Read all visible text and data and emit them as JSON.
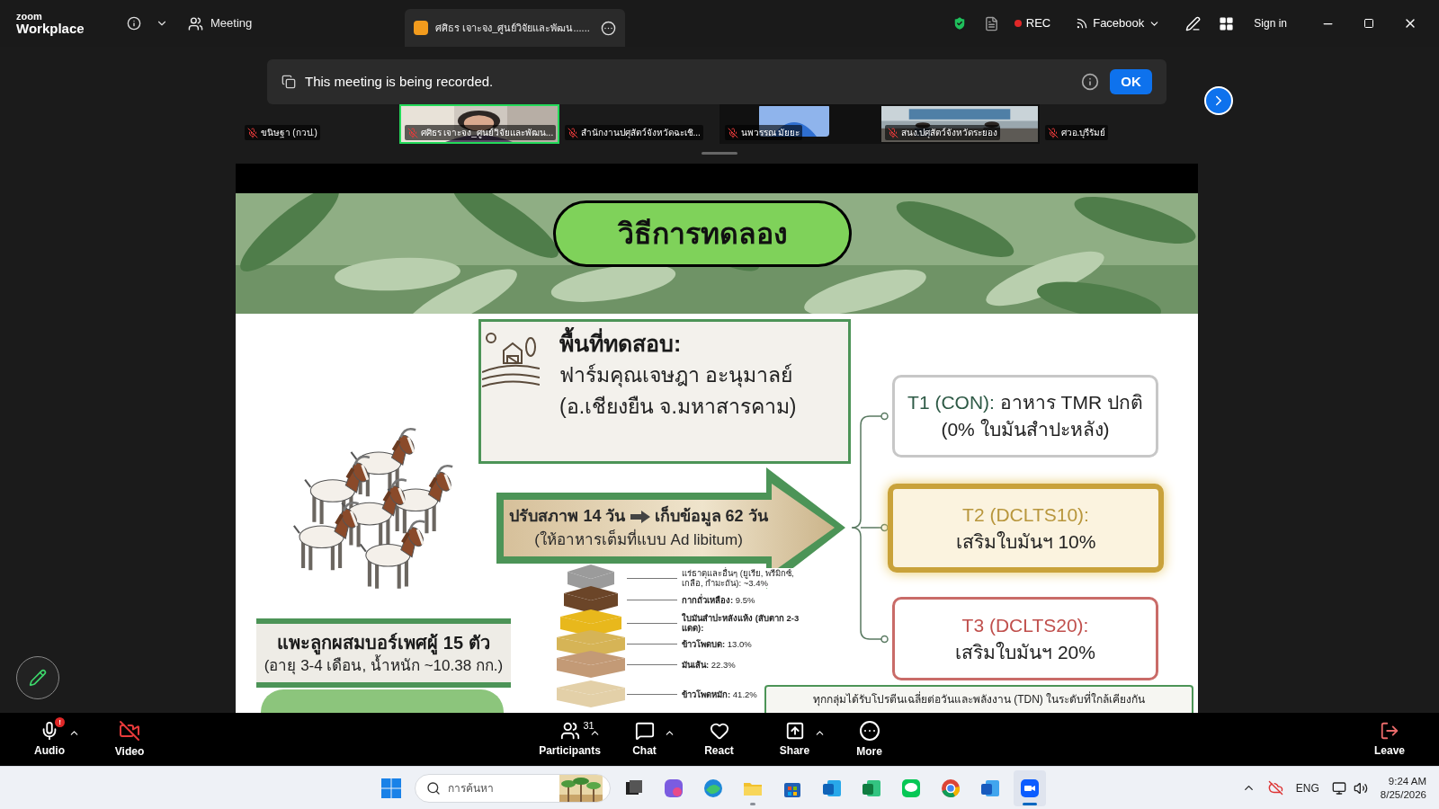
{
  "title_bar": {
    "logo_top": "zoom",
    "logo_bottom": "Workplace",
    "meeting_label": "Meeting",
    "tab_title": "ศศิธร เจาะจง_ศูนย์วิจัยและพัฒน......",
    "recording": "REC",
    "stream": "Facebook",
    "sign_in": "Sign in"
  },
  "banner": {
    "message": "This meeting is being recorded.",
    "button": "OK"
  },
  "participants": [
    {
      "name": "ขนิษฐา (กวป.)",
      "kind": "blank",
      "muted": true,
      "selected": false
    },
    {
      "name": "ศศิธร เจาะจง_ศูนย์วิจัยและพัฒน...",
      "kind": "person",
      "muted": true,
      "selected": true
    },
    {
      "name": "สำนักงานปศุสัตว์จังหวัดฉะเชิ...",
      "kind": "blank",
      "muted": true,
      "selected": false
    },
    {
      "name": "นพวรรณ มัยยะ",
      "kind": "avatar",
      "muted": true,
      "selected": false
    },
    {
      "name": "สนง.ปศุสัตว์จังหวัดระยอง",
      "kind": "room",
      "muted": true,
      "selected": false
    },
    {
      "name": "ศวอ.บุรีรัมย์",
      "kind": "blank",
      "muted": true,
      "selected": false
    }
  ],
  "slide": {
    "title": "วิธีการทดลอง",
    "site": {
      "heading": "พื้นที่ทดสอบ:",
      "lines": [
        "ฟาร์มคุณเจษฎา อะนุมาลย์",
        "(อ.เชียงยืน จ.มหาสารคาม)"
      ]
    },
    "phase": {
      "from": "ปรับสภาพ 14 วัน",
      "to": "เก็บข้อมูล 62 วัน",
      "note": "(ให้อาหารเต็มที่แบบ Ad libitum)"
    },
    "animals": {
      "heading": "แพะลูกผสมบอร์เพศผู้ 15 ตัว",
      "note": "(อายุ 3-4 เดือน, น้ำหนัก ~10.38 กก.)"
    },
    "ration": [
      {
        "name": "แร่ธาตุและอื่นๆ (ยูเรีย, พรีมิกซ์, เกลือ, กำมะถัน):",
        "value": "~3.4%",
        "bold": false,
        "color": "#9b9b9b"
      },
      {
        "name": "กากถั่วเหลือง:",
        "value": "9.5%",
        "bold": true,
        "color": "#6b4528"
      },
      {
        "name": "ใบมันสำปะหลังแห้ง (สับตาก 2-3 แดด):",
        "bold": true,
        "color": "#e8b81c"
      },
      {
        "name": "ข้าวโพดบด:",
        "value": "13.0%",
        "bold": true,
        "color": "#d6b456"
      },
      {
        "name": "มันเส้น:",
        "value": "22.3%",
        "bold": true,
        "color": "#c39a76"
      },
      {
        "name": "ข้าวโพดหมัก:",
        "value": "41.2%",
        "bold": true,
        "color": "#e3d0a8"
      }
    ],
    "treatments": [
      {
        "label": "T1 (CON):",
        "text": "อาหาร TMR ปกติ",
        "note": "(0% ใบมันสำปะหลัง)",
        "kind": "plain"
      },
      {
        "label": "T2 (DCLTS10):",
        "note": "เสริมใบมันฯ 10%",
        "kind": "featured"
      },
      {
        "label": "T3 (DCLTS20):",
        "note": "เสริมใบมันฯ 20%",
        "kind": "alert"
      }
    ],
    "footnote": "ทุกกลุ่มได้รับโปรตีนเฉลี่ยต่อวันและพลังงาน (TDN) ในระดับที่ใกล้เคียงกัน"
  },
  "toolbar": [
    {
      "label": "Audio",
      "kind": "audio",
      "menu": true,
      "off": false,
      "badge": "!"
    },
    {
      "label": "Video",
      "kind": "video",
      "menu": false,
      "off": true
    },
    {
      "label": "Participants",
      "kind": "participants",
      "menu": true,
      "count": "31"
    },
    {
      "label": "Chat",
      "kind": "chat",
      "menu": true
    },
    {
      "label": "React",
      "kind": "react",
      "menu": false
    },
    {
      "label": "Share",
      "kind": "share",
      "menu": true
    },
    {
      "label": "More",
      "kind": "more",
      "menu": false
    },
    {
      "label": "Leave",
      "kind": "leave",
      "menu": false
    }
  ],
  "taskbar": {
    "search_placeholder": "การค้นหา",
    "apps": [
      {
        "kind": "taskview",
        "running": false,
        "selected": false
      },
      {
        "kind": "m365",
        "running": false,
        "selected": false
      },
      {
        "kind": "edge",
        "running": false,
        "selected": false
      },
      {
        "kind": "explorer",
        "running": true,
        "selected": false
      },
      {
        "kind": "store",
        "running": false,
        "selected": false
      },
      {
        "kind": "outlook",
        "running": false,
        "selected": false
      },
      {
        "kind": "excel",
        "running": false,
        "selected": false
      },
      {
        "kind": "line",
        "running": false,
        "selected": false
      },
      {
        "kind": "chrome",
        "running": false,
        "selected": false
      },
      {
        "kind": "word",
        "running": false,
        "selected": false
      },
      {
        "kind": "zoom",
        "running": true,
        "selected": true
      }
    ],
    "language": "ENG",
    "time": "9:24 AM",
    "date": "8/25/2026"
  }
}
